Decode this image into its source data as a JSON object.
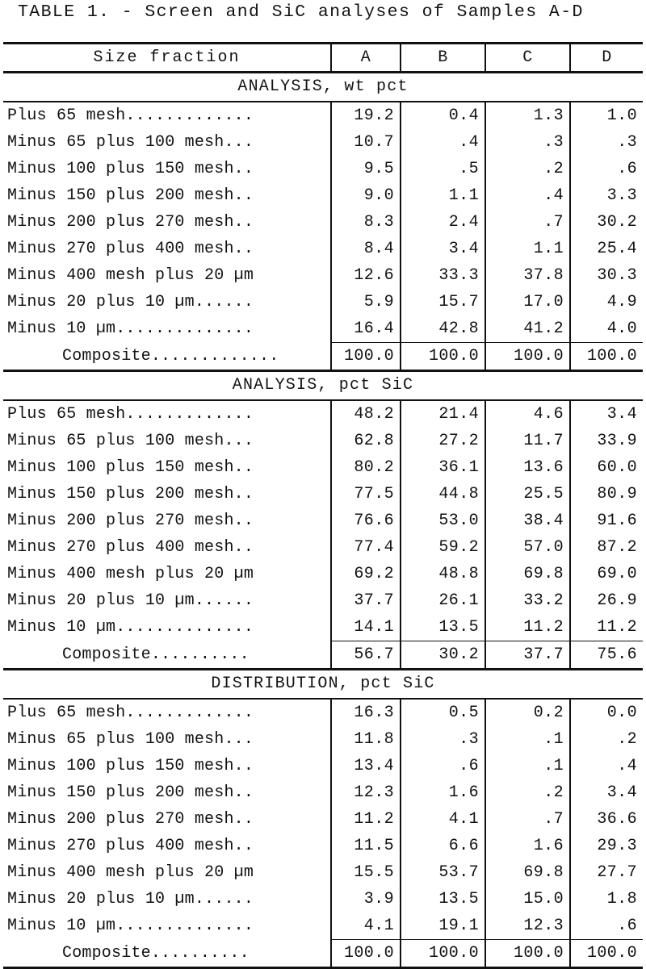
{
  "title": "TABLE 1. - Screen and SiC analyses of Samples A-D",
  "header": {
    "label": "Size fraction",
    "columns": [
      "A",
      "B",
      "C",
      "D"
    ]
  },
  "row_labels": [
    "Plus 65 mesh.............",
    "Minus 65 plus 100 mesh...",
    "Minus 100 plus 150 mesh..",
    "Minus 150 plus 200 mesh..",
    "Minus 200 plus 270 mesh..",
    "Minus 270 plus 400 mesh..",
    "Minus 400 mesh plus 20 µm",
    "Minus 20 plus 10 µm......",
    "Minus 10 µm.............."
  ],
  "composite_labels": {
    "long": "Composite.............",
    "short": "Composite.........."
  },
  "sections": [
    {
      "title": "ANALYSIS, wt pct",
      "values": [
        [
          "19.2",
          "0.4",
          "1.3",
          "1.0"
        ],
        [
          "10.7",
          ".4",
          ".3",
          ".3"
        ],
        [
          "9.5",
          ".5",
          ".2",
          ".6"
        ],
        [
          "9.0",
          "1.1",
          ".4",
          "3.3"
        ],
        [
          "8.3",
          "2.4",
          ".7",
          "30.2"
        ],
        [
          "8.4",
          "3.4",
          "1.1",
          "25.4"
        ],
        [
          "12.6",
          "33.3",
          "37.8",
          "30.3"
        ],
        [
          "5.9",
          "15.7",
          "17.0",
          "4.9"
        ],
        [
          "16.4",
          "42.8",
          "41.2",
          "4.0"
        ]
      ],
      "composite": [
        "100.0",
        "100.0",
        "100.0",
        "100.0"
      ],
      "composite_label_kind": "long"
    },
    {
      "title": "ANALYSIS, pct SiC",
      "values": [
        [
          "48.2",
          "21.4",
          "4.6",
          "3.4"
        ],
        [
          "62.8",
          "27.2",
          "11.7",
          "33.9"
        ],
        [
          "80.2",
          "36.1",
          "13.6",
          "60.0"
        ],
        [
          "77.5",
          "44.8",
          "25.5",
          "80.9"
        ],
        [
          "76.6",
          "53.0",
          "38.4",
          "91.6"
        ],
        [
          "77.4",
          "59.2",
          "57.0",
          "87.2"
        ],
        [
          "69.2",
          "48.8",
          "69.8",
          "69.0"
        ],
        [
          "37.7",
          "26.1",
          "33.2",
          "26.9"
        ],
        [
          "14.1",
          "13.5",
          "11.2",
          "11.2"
        ]
      ],
      "composite": [
        "56.7",
        "30.2",
        "37.7",
        "75.6"
      ],
      "composite_label_kind": "short"
    },
    {
      "title": "DISTRIBUTION, pct SiC",
      "values": [
        [
          "16.3",
          "0.5",
          "0.2",
          "0.0"
        ],
        [
          "11.8",
          ".3",
          ".1",
          ".2"
        ],
        [
          "13.4",
          ".6",
          ".1",
          ".4"
        ],
        [
          "12.3",
          "1.6",
          ".2",
          "3.4"
        ],
        [
          "11.2",
          "4.1",
          ".7",
          "36.6"
        ],
        [
          "11.5",
          "6.6",
          "1.6",
          "29.3"
        ],
        [
          "15.5",
          "53.7",
          "69.8",
          "27.7"
        ],
        [
          "3.9",
          "13.5",
          "15.0",
          "1.8"
        ],
        [
          "4.1",
          "19.1",
          "12.3",
          ".6"
        ]
      ],
      "composite": [
        "100.0",
        "100.0",
        "100.0",
        "100.0"
      ],
      "composite_label_kind": "short"
    }
  ]
}
